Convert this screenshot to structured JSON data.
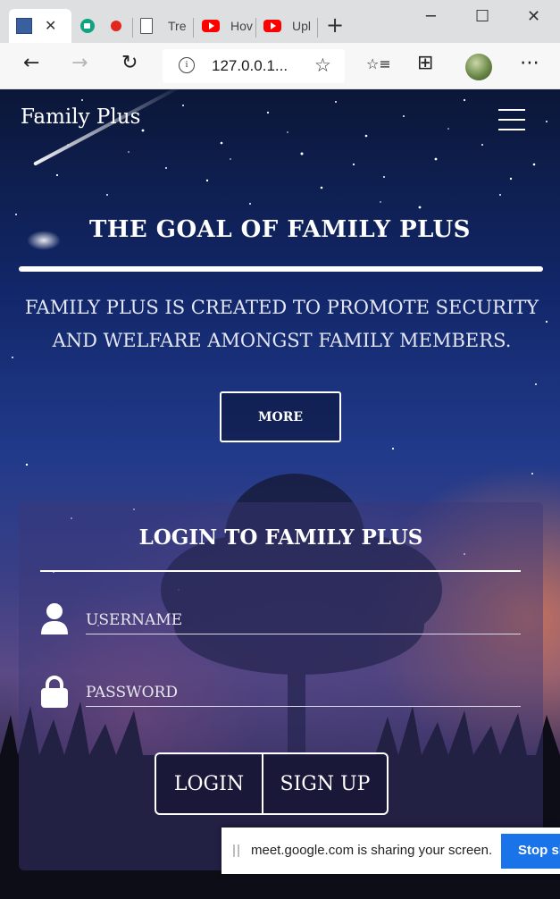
{
  "browser": {
    "tabs": [
      {
        "icon": "site-favicon-icon",
        "label": "",
        "close": "✕"
      },
      {
        "icon": "google-meet-icon",
        "label": ""
      },
      {
        "icon": "recording-dot-icon",
        "label": ""
      },
      {
        "icon": "document-icon",
        "label": "Tre"
      },
      {
        "icon": "youtube-icon",
        "label": "Hov"
      },
      {
        "icon": "youtube-icon",
        "label": "Upl"
      }
    ],
    "new_tab": "+",
    "window_controls": {
      "minimize": "─",
      "maximize": "☐",
      "close": "✕"
    },
    "toolbar": {
      "back": "←",
      "forward": "→",
      "refresh": "↻",
      "info": "i",
      "url": "127.0.0.1...",
      "star": "☆",
      "favorites": "☆≡",
      "collections": "⊞",
      "more": "⋯"
    }
  },
  "page": {
    "brand": "Family Plus",
    "goal": {
      "title": "THE GOAL OF FAMILY PLUS",
      "text": "FAMILY PLUS IS CREATED TO PROMOTE SECURITY AND WELFARE AMONGST FAMILY MEMBERS.",
      "more_label": "MORE"
    },
    "login": {
      "title": "LOGIN TO FAMILY PLUS",
      "username_placeholder": "USERNAME",
      "password_placeholder": "PASSWORD",
      "login_label": "LOGIN",
      "signup_label": "SIGN UP"
    }
  },
  "share_bar": {
    "message": "meet.google.com is sharing your screen.",
    "stop_label": "Stop sharing"
  },
  "colors": {
    "sky_top": "#0b1738",
    "sky_mid": "#213a8a",
    "sunset_glow": "#f08250",
    "share_button": "#1a73e8",
    "youtube_red": "#ff0000"
  }
}
